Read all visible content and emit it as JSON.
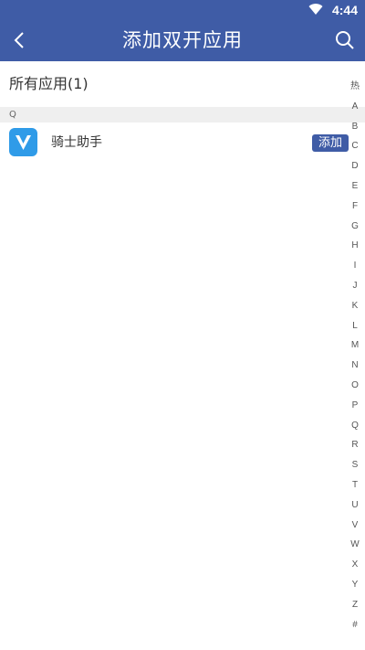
{
  "status_bar": {
    "time": "4:44"
  },
  "app_bar": {
    "title": "添加双开应用"
  },
  "section": {
    "title": "所有应用(1)"
  },
  "group": {
    "letter": "Q"
  },
  "apps": [
    {
      "name": "骑士助手",
      "add_label": "添加"
    }
  ],
  "index_letters": [
    "热",
    "A",
    "B",
    "C",
    "D",
    "E",
    "F",
    "G",
    "H",
    "I",
    "J",
    "K",
    "L",
    "M",
    "N",
    "O",
    "P",
    "Q",
    "R",
    "S",
    "T",
    "U",
    "V",
    "W",
    "X",
    "Y",
    "Z",
    "#"
  ],
  "colors": {
    "primary": "#3f5ca6",
    "app_icon": "#2f9be8",
    "group_bg": "#efefef"
  }
}
